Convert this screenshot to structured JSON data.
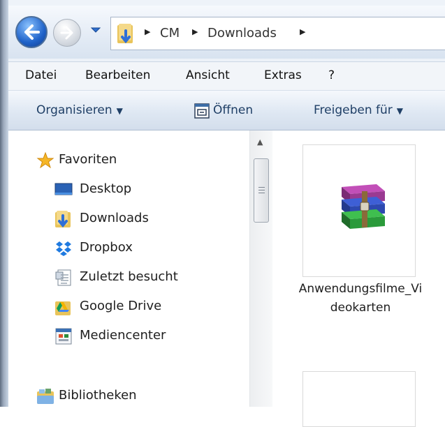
{
  "address": {
    "crumbs": [
      "CM",
      "Downloads"
    ]
  },
  "menu": {
    "items": [
      "Datei",
      "Bearbeiten",
      "Ansicht",
      "Extras",
      "?"
    ]
  },
  "toolbar": {
    "organize": "Organisieren",
    "open": "Öffnen",
    "share": "Freigeben für"
  },
  "nav": {
    "favorites": {
      "label": "Favoriten",
      "items": [
        {
          "label": "Desktop",
          "icon": "desktop-icon"
        },
        {
          "label": "Downloads",
          "icon": "downloads-folder-icon"
        },
        {
          "label": "Dropbox",
          "icon": "dropbox-icon"
        },
        {
          "label": "Zuletzt besucht",
          "icon": "recent-places-icon"
        },
        {
          "label": "Google Drive",
          "icon": "google-drive-icon"
        },
        {
          "label": "Mediencenter",
          "icon": "media-center-icon"
        }
      ]
    },
    "libraries": {
      "label": "Bibliotheken"
    }
  },
  "files": [
    {
      "name": "Anwendungsfilme_Videokarten",
      "icon": "winrar-archive-icon"
    }
  ],
  "colors": {
    "accent": "#1f3f66",
    "back_button": "#1f62c9"
  }
}
